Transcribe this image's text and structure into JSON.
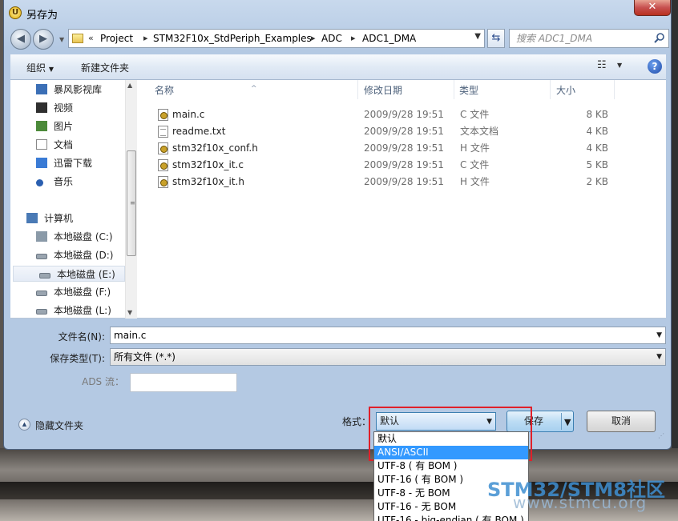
{
  "window": {
    "title": "另存为",
    "close": "✕"
  },
  "address": {
    "crumbs": [
      "Project",
      "STM32F10x_StdPeriph_Examples",
      "ADC",
      "ADC1_DMA"
    ]
  },
  "search": {
    "placeholder": "搜索 ADC1_DMA"
  },
  "toolbar": {
    "organize": "组织",
    "new_folder": "新建文件夹",
    "help": "?"
  },
  "sidebar": {
    "items": [
      {
        "label": "暴风影视库",
        "icon": "video-library-icon"
      },
      {
        "label": "视频",
        "icon": "video-icon"
      },
      {
        "label": "图片",
        "icon": "picture-icon"
      },
      {
        "label": "文档",
        "icon": "document-icon"
      },
      {
        "label": "迅雷下载",
        "icon": "download-icon"
      },
      {
        "label": "音乐",
        "icon": "music-icon"
      },
      {
        "label": "计算机",
        "icon": "computer-icon"
      },
      {
        "label": "本地磁盘 (C:)",
        "icon": "system-drive-icon"
      },
      {
        "label": "本地磁盘 (D:)",
        "icon": "drive-icon"
      },
      {
        "label": "本地磁盘 (E:)",
        "icon": "drive-icon"
      },
      {
        "label": "本地磁盘 (F:)",
        "icon": "drive-icon"
      },
      {
        "label": "本地磁盘 (L:)",
        "icon": "drive-icon"
      }
    ],
    "selected": "本地磁盘 (E:)"
  },
  "columns": {
    "name": "名称",
    "date": "修改日期",
    "type": "类型",
    "size": "大小"
  },
  "files": [
    {
      "name": "main.c",
      "date": "2009/9/28 19:51",
      "type": "C 文件",
      "size": "8 KB",
      "kind": "src"
    },
    {
      "name": "readme.txt",
      "date": "2009/9/28 19:51",
      "type": "文本文档",
      "size": "4 KB",
      "kind": "txt"
    },
    {
      "name": "stm32f10x_conf.h",
      "date": "2009/9/28 19:51",
      "type": "H 文件",
      "size": "4 KB",
      "kind": "src"
    },
    {
      "name": "stm32f10x_it.c",
      "date": "2009/9/28 19:51",
      "type": "C 文件",
      "size": "5 KB",
      "kind": "src"
    },
    {
      "name": "stm32f10x_it.h",
      "date": "2009/9/28 19:51",
      "type": "H 文件",
      "size": "2 KB",
      "kind": "src"
    }
  ],
  "form": {
    "filename_label": "文件名(N):",
    "filename_value": "main.c",
    "filetype_label": "保存类型(T):",
    "filetype_value": "所有文件 (*.*)",
    "ads_label": "ADS 流："
  },
  "footer": {
    "hide_folders": "隐藏文件夹",
    "encoding_label": "格式：",
    "encoding_value": "默认",
    "save": "保存",
    "cancel": "取消"
  },
  "encoding_options": [
    "默认",
    "ANSI/ASCII",
    "UTF-8 ( 有 BOM )",
    "UTF-16 ( 有 BOM )",
    "UTF-8 - 无 BOM",
    "UTF-16 - 无 BOM",
    "UTF-16 - big-endian ( 有 BOM )"
  ],
  "encoding_highlighted": "ANSI/ASCII",
  "watermark": {
    "brand": "STM32/STM8社区",
    "url": "www.stmcu.org"
  },
  "colors": {
    "highlight": "#3399ff",
    "red_annotation": "#e0202a",
    "accent_blue": "#3c7fb1"
  }
}
